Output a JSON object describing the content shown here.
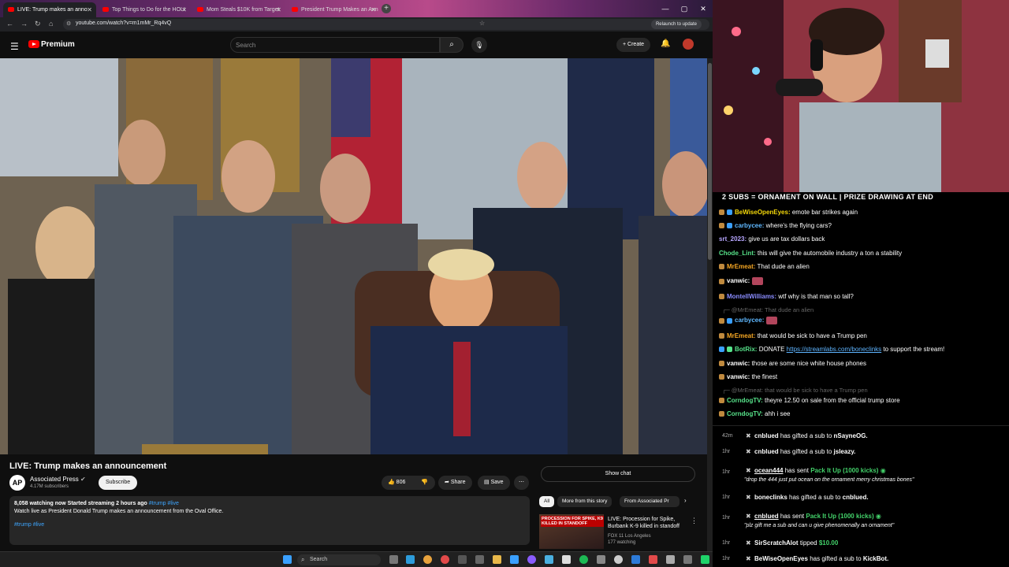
{
  "browser": {
    "tabs": [
      {
        "title": "LIVE: Trump makes an anno",
        "active": true
      },
      {
        "title": "Top Things to Do for the HOLI",
        "active": false
      },
      {
        "title": "Mom Steals $10K from Target",
        "active": false
      },
      {
        "title": "President Trump Makes an Ann",
        "active": false
      }
    ],
    "url": "youtube.com/watch?v=m1mMr_Rq4vQ",
    "relaunch_label": "Relaunch to update"
  },
  "youtube": {
    "brand": "Premium",
    "search_placeholder": "Search",
    "create_label": "Create",
    "video": {
      "title": "LIVE: Trump makes an announcement",
      "channel": "Associated Press",
      "channel_avatar_text": "AP",
      "subscribers": "4.17M subscribers",
      "subscribe_label": "Subscribe",
      "likes": "806",
      "share_label": "Share",
      "save_label": "Save",
      "stats": "8,058 watching now  Started streaming 2 hours ago",
      "stats_tags": "#trump #live",
      "description": "Watch live as President Donald Trump makes an announcement from the Oval Office.",
      "tags": "#trump #live"
    },
    "show_chat_label": "Show chat",
    "chips": [
      "All",
      "More from this story",
      "From Associated Pr"
    ],
    "recommended": {
      "thumb_caption": "PROCESSION FOR SPIKE, K9 KILLED IN STANDOFF",
      "title": "LIVE: Procession for Spike, Burbank K-9 killed in standoff",
      "channel": "FOX 11 Los Angeles",
      "meta": "177 watching"
    }
  },
  "stream": {
    "banner": "2 SUBS = ORNAMENT ON WALL | PRIZE DRAWING AT END"
  },
  "chat": [
    {
      "user": "BeWiseOpenEyes:",
      "color": "#f5d90a",
      "text": "emote bar strikes again",
      "badge": "#3aa0ff"
    },
    {
      "user": "carbycee:",
      "color": "#5fb8ff",
      "text": "where's the flying cars?",
      "badge": "#3aa0ff"
    },
    {
      "user": "srt_2023:",
      "color": "#b7a6ff",
      "text": "give us are tax dollars back",
      "badge": ""
    },
    {
      "user": "Chode_Lint:",
      "color": "#57e38a",
      "text": "this will give the automobile industry a ton a stability",
      "badge": ""
    },
    {
      "user": "MrEmeat:",
      "color": "#f5a623",
      "text": "That dude an alien",
      "badge": "#c08a3e"
    },
    {
      "user": "vanwic:",
      "color": "#ffffff",
      "text": "",
      "badge": "#c08a3e",
      "emote": true
    },
    {
      "user": "MontellWilliams:",
      "color": "#8a8cff",
      "text": "wtf why is that man so tall?",
      "badge": "#c08a3e"
    },
    {
      "reply": "@MrEmeat: That dude an alien"
    },
    {
      "user": "carbycee:",
      "color": "#5fb8ff",
      "text": "",
      "badge": "#3aa0ff",
      "emote": true
    },
    {
      "user": "MrEmeat:",
      "color": "#f5a623",
      "text": "that would be sick to have a Trump pen",
      "badge": "#c08a3e"
    },
    {
      "user": "BotRix:",
      "color": "#57e38a",
      "text": "DONATE",
      "link": "https://streamlabs.com/boneclinks",
      "text_after": "to support the stream!",
      "badge": "#3aa0ff"
    },
    {
      "user": "vanwic:",
      "color": "#ffffff",
      "text": "those are some nice white house phones",
      "badge": "#c08a3e"
    },
    {
      "user": "vanwic:",
      "color": "#ffffff",
      "text": "the finest",
      "badge": "#c08a3e"
    },
    {
      "reply": "@MrEmeat: that would be sick to have a Trump pen"
    },
    {
      "user": "CorndogTV:",
      "color": "#57e38a",
      "text": "theyre 12.50 on sale from the official trump store",
      "badge": "#c08a3e"
    },
    {
      "user": "CorndogTV:",
      "color": "#57e38a",
      "text": "ahh i see",
      "badge": "#c08a3e"
    }
  ],
  "events": [
    {
      "time": "42m",
      "user": "cnblued",
      "action": "has gifted a sub to",
      "target": "nSayneOG."
    },
    {
      "time": "1hr",
      "user": "cnblued",
      "action": "has gifted a sub to",
      "target": "jsleazy."
    },
    {
      "time": "1hr",
      "user": "ocean444",
      "action": "has sent",
      "gift": "Pack It Up (1000 kicks)",
      "message": "\"drop the 444 just put ocean on the ornament merry christmas bones\""
    },
    {
      "time": "1hr",
      "user": "boneclinks",
      "action": "has gifted a sub to",
      "target": "cnblued."
    },
    {
      "time": "1hr",
      "user": "cnblued",
      "action": "has sent",
      "gift": "Pack It Up (1000 kicks)",
      "message": "\"plz gift me a sub and can u give phenomenally an ornament\""
    },
    {
      "time": "1hr",
      "user": "SirScratchAlot",
      "action": "tipped",
      "target": "$10.00"
    },
    {
      "time": "1hr",
      "user": "BeWiseOpenEyes",
      "action": "has gifted a sub to",
      "target": "KickBot."
    }
  ],
  "taskbar": {
    "search_label": "Search"
  }
}
